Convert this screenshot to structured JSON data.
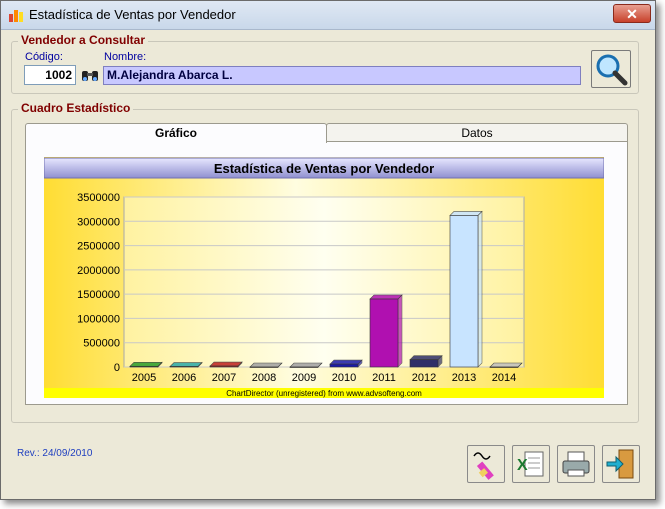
{
  "window": {
    "title": "Estadística de Ventas por Vendedor",
    "close_label": "✕"
  },
  "vendedor": {
    "group_label": "Vendedor a Consultar",
    "codigo_label": "Código:",
    "codigo_value": "1002",
    "nombre_label": "Nombre:",
    "nombre_value": "M.Alejandra Abarca L."
  },
  "cuadro": {
    "group_label": "Cuadro Estadístico",
    "tabs": [
      {
        "label": "Gráfico",
        "active": true
      },
      {
        "label": "Datos",
        "active": false
      }
    ]
  },
  "footer": {
    "rev": "Rev.: 24/09/2010"
  },
  "icons": {
    "app": "app-icon",
    "binoculars": "binoculars-icon",
    "search": "magnifier-icon",
    "report": "pencil-report-icon",
    "excel": "excel-icon",
    "print": "printer-icon",
    "exit": "exit-door-icon"
  },
  "chart_data": {
    "type": "bar",
    "title": "Estadística de Ventas por Vendedor",
    "footnote": "ChartDirector (unregistered) from www.advsofteng.com",
    "categories": [
      "2005",
      "2006",
      "2007",
      "2008",
      "2009",
      "2010",
      "2011",
      "2012",
      "2013",
      "2014"
    ],
    "values": [
      15000,
      10000,
      20000,
      0,
      0,
      60000,
      1400000,
      150000,
      3120000,
      0
    ],
    "ylim": [
      0,
      3500000
    ],
    "yticks": [
      "0",
      "500000",
      "1000000",
      "1500000",
      "2000000",
      "2500000",
      "3000000",
      "3500000"
    ],
    "bar_colors": [
      "#2a9c2a",
      "#2aa8a8",
      "#c02020",
      "#a0a0a0",
      "#a0a0a0",
      "#1a1aa8",
      "#b010b0",
      "#303068",
      "#c8e4ff",
      "#c0c0c0"
    ],
    "grid": true
  }
}
